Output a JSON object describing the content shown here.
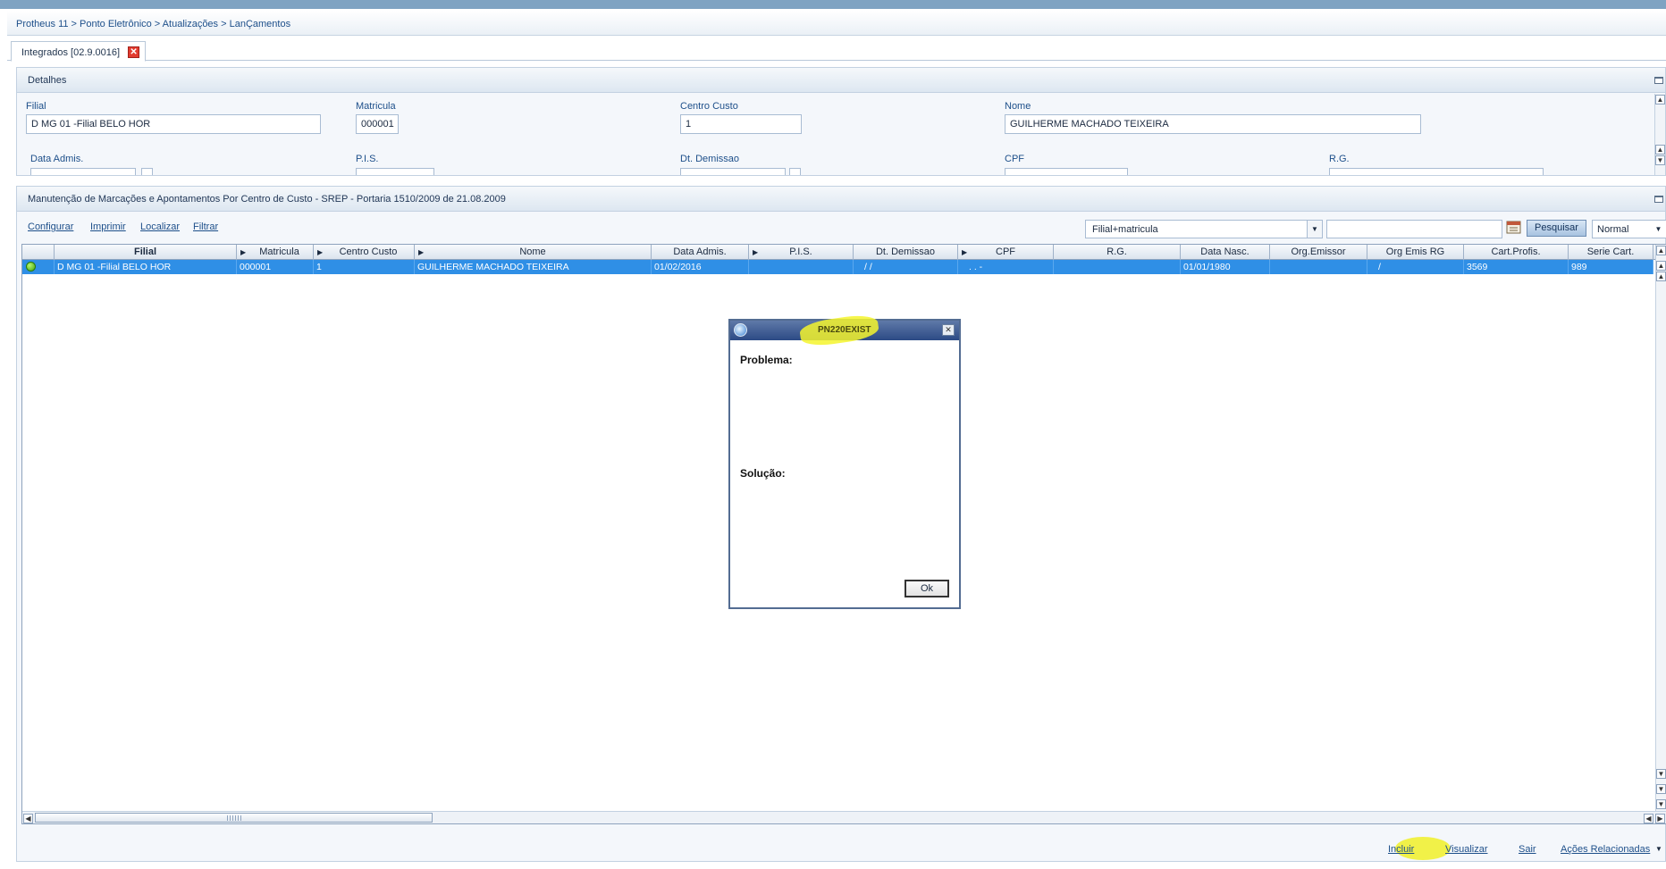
{
  "breadcrumb": "Protheus 11 > Ponto Eletrônico > Atualizações > LanÇamentos",
  "tab": {
    "label": "Integrados [02.9.0016]",
    "close": "✕"
  },
  "details": {
    "title": "Detalhes",
    "fields": [
      {
        "label": "Filial",
        "value": "D MG 01 -Filial BELO HOR"
      },
      {
        "label": "Matricula",
        "value": "000001"
      },
      {
        "label": "Centro Custo",
        "value": "1"
      },
      {
        "label": "Nome",
        "value": "GUILHERME MACHADO TEIXEIRA"
      }
    ],
    "row2_labels": [
      "Data Admis.",
      "P.I.S.",
      "Dt. Demissao",
      "CPF",
      "R.G."
    ]
  },
  "browse": {
    "title": "Manutenção de Marcações e Apontamentos Por Centro de Custo - SREP - Portaria 1510/2009 de 21.08.2009",
    "toolbar": [
      "Configurar",
      "Imprimir",
      "Localizar",
      "Filtrar"
    ],
    "order": "Filial+matricula",
    "search_button": "Pesquisar",
    "view_mode": "Normal",
    "columns": [
      "Filial",
      "Matricula",
      "Centro Custo",
      "Nome",
      "Data Admis.",
      "P.I.S.",
      "Dt. Demissao",
      "CPF",
      "R.G.",
      "Data Nasc.",
      "Org.Emissor",
      "Org Emis RG",
      "Cart.Profis.",
      "Serie Cart."
    ],
    "rows": [
      [
        "D MG 01 -Filial BELO HOR",
        "000001",
        "1",
        "GUILHERME MACHADO TEIXEIRA",
        "01/02/2016",
        "",
        " /  /",
        " .   .   -",
        "",
        "01/01/1980",
        "",
        "/",
        "3569",
        "989"
      ]
    ]
  },
  "actions": [
    "Incluir",
    "Visualizar",
    "Sair",
    "Ações Relacionadas"
  ],
  "dialog": {
    "title": "PN220EXIST",
    "problem_label": "Problema:",
    "solution_label": "Solução:",
    "ok": "Ok"
  },
  "colors": {
    "selection": "#2f8fe6",
    "highlight": "#f0f028",
    "title_bar": "#2c4a85"
  }
}
